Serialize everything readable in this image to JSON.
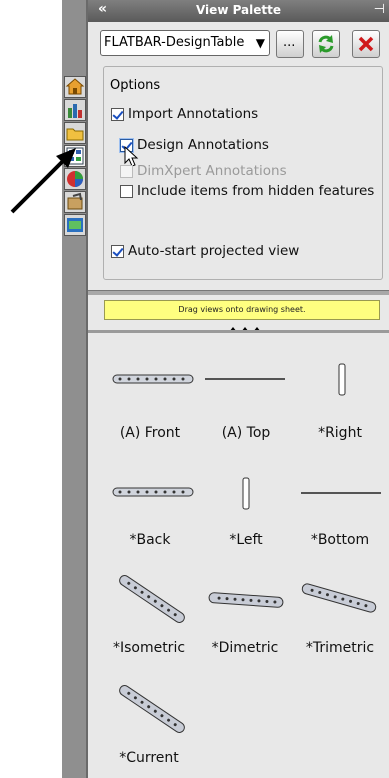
{
  "palette": {
    "title": "View Palette",
    "collapse_icon": "double-chevron-left-icon",
    "pin_icon": "pin-icon",
    "document": "FLATBAR-DesignTable",
    "browse_label": "...",
    "refresh_icon": "refresh-icon",
    "close_icon": "close-icon"
  },
  "options": {
    "group_label": "Options",
    "import_annotations": {
      "label": "Import Annotations",
      "checked": true
    },
    "design_annotations": {
      "label": "Design Annotations",
      "checked": true
    },
    "dimxpert_annotations": {
      "label": "DimXpert Annotations",
      "checked": false,
      "disabled": true
    },
    "hidden_features": {
      "label": "Include items from hidden features",
      "checked": false
    },
    "auto_start": {
      "label": "Auto-start projected view",
      "checked": true
    }
  },
  "hint": "Drag views onto drawing sheet.",
  "views": [
    {
      "label": "(A) Front"
    },
    {
      "label": "(A) Top"
    },
    {
      "label": "*Right"
    },
    {
      "label": "*Back"
    },
    {
      "label": "*Left"
    },
    {
      "label": "*Bottom"
    },
    {
      "label": "*Isometric"
    },
    {
      "label": "*Dimetric"
    },
    {
      "label": "*Trimetric"
    },
    {
      "label": "*Current"
    }
  ],
  "colors": {
    "titlebar": "#6b6b6b",
    "hint_bg": "#ffff80",
    "check_blue": "#1a4fc0",
    "close_red": "#d0191b"
  }
}
